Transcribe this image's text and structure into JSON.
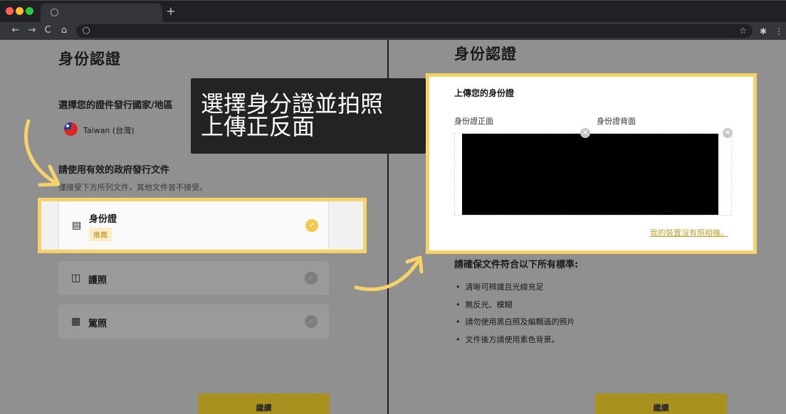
{
  "browser": {
    "new_tab": "+",
    "nav_back": "←",
    "nav_forward": "→",
    "nav_reload": "C",
    "nav_home": "⌂",
    "bookmark": "☆",
    "extensions": "✱",
    "menu": "⋮"
  },
  "left": {
    "title": "身份認證",
    "country_label": "選擇您的證件發行國家/地區",
    "country_value": "Taiwan (台灣)",
    "docs_label": "請使用有效的政府發行文件",
    "docs_note": "僅接受下方所列文件，其他文件皆不接受。",
    "doc_items": [
      {
        "name": "身份證",
        "badge": "推薦",
        "icon": "id-card-icon",
        "glyph": "▤"
      },
      {
        "name": "護照",
        "icon": "passport-icon",
        "glyph": "◫"
      },
      {
        "name": "駕照",
        "icon": "driver-license-icon",
        "glyph": "▦"
      }
    ],
    "continue_label": "繼續"
  },
  "callout": {
    "line1": "選擇身分證並拍照",
    "line2": "上傳正反面"
  },
  "right": {
    "title": "身份認證",
    "upload_title": "上傳您的身份證",
    "front_label": "身份證正面",
    "back_label": "身份證背面",
    "no_camera_link": "我的裝置沒有照相機。",
    "criteria_title": "請確保文件符合以下所有標準:",
    "criteria": [
      "清晰可辨識且光線充足",
      "無反光、模糊",
      "請勿使用黑白照及編輯過的照片",
      "文件後方請使用素色背景。"
    ],
    "continue_label": "繼續"
  },
  "colors": {
    "highlight": "#f5d26a",
    "accent": "#f1c84b",
    "link": "#c9a232"
  }
}
